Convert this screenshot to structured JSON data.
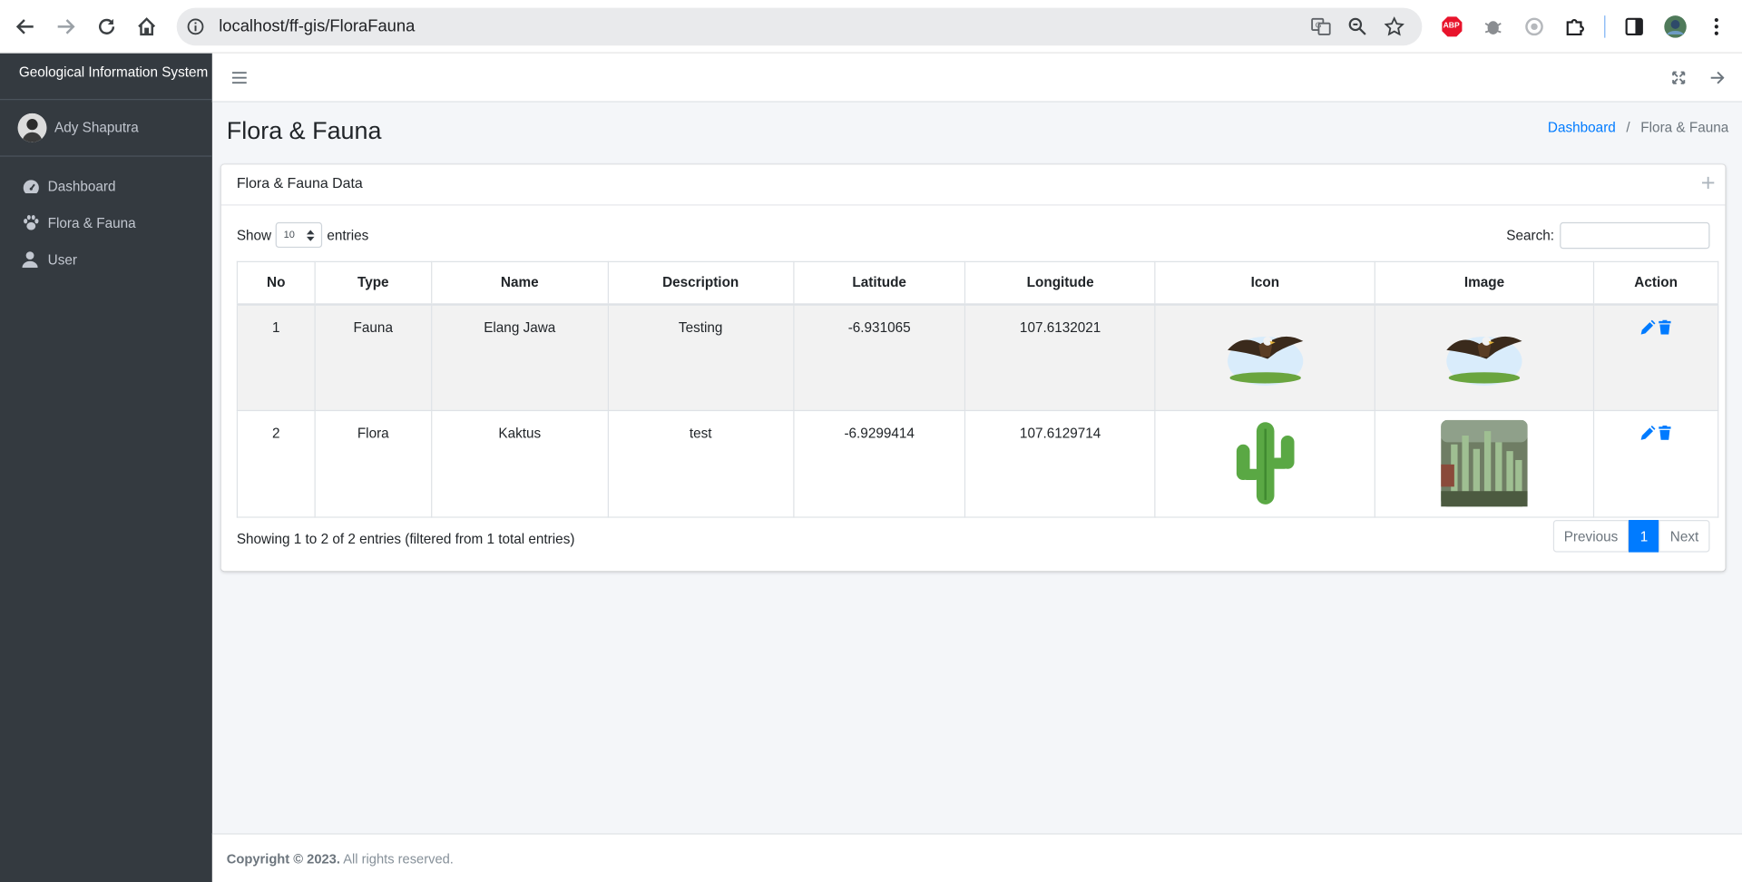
{
  "browser": {
    "url": "localhost/ff-gis/FloraFauna",
    "icons": [
      "back-icon",
      "forward-icon",
      "reload-icon",
      "home-icon",
      "site-info-icon",
      "translate-icon",
      "zoom-icon",
      "bookmark-star-icon",
      "adblock-icon",
      "bug-extension-icon",
      "circle-extension-icon",
      "extensions-puzzle-icon",
      "side-panel-icon",
      "profile-avatar-icon",
      "kebab-menu-icon"
    ],
    "adblock_label": "ABP"
  },
  "sidebar": {
    "brand": "Geological Information System",
    "user_name": "Ady Shaputra",
    "items": [
      {
        "label": "Dashboard",
        "icon": "tachometer-icon"
      },
      {
        "label": "Flora & Fauna",
        "icon": "paw-icon"
      },
      {
        "label": "User",
        "icon": "user-icon"
      }
    ]
  },
  "header": {
    "menu_icon": "hamburger-icon",
    "fullscreen_icon": "expand-icon",
    "logout_icon": "arrow-right-icon"
  },
  "page": {
    "title": "Flora & Fauna",
    "breadcrumb": {
      "home": "Dashboard",
      "sep": "/",
      "current": "Flora & Fauna"
    }
  },
  "card": {
    "title": "Flora & Fauna Data",
    "tool_icon": "plus-icon",
    "length": {
      "show": "Show",
      "value": "10",
      "entries": "entries"
    },
    "search_label": "Search:",
    "search_value": "",
    "columns": [
      "No",
      "Type",
      "Name",
      "Description",
      "Latitude",
      "Longitude",
      "Icon",
      "Image",
      "Action"
    ],
    "rows": [
      {
        "no": "1",
        "type": "Fauna",
        "name": "Elang Jawa",
        "description": "Testing",
        "latitude": "-6.931065",
        "longitude": "107.6132021",
        "icon": "eagle-image",
        "image": "eagle-image"
      },
      {
        "no": "2",
        "type": "Flora",
        "name": "Kaktus",
        "description": "test",
        "latitude": "-6.9299414",
        "longitude": "107.6129714",
        "icon": "cactus-emoji-image",
        "image": "cactus-photo-image"
      }
    ],
    "info": "Showing 1 to 2 of 2 entries (filtered from 1 total entries)",
    "pagination": {
      "previous": "Previous",
      "current": "1",
      "next": "Next"
    }
  },
  "footer": {
    "copyright": "Copyright © 2023.",
    "rights": " All rights reserved."
  },
  "colors": {
    "sidebar": "#343a40",
    "primary": "#007bff",
    "background": "#f4f6f9"
  }
}
